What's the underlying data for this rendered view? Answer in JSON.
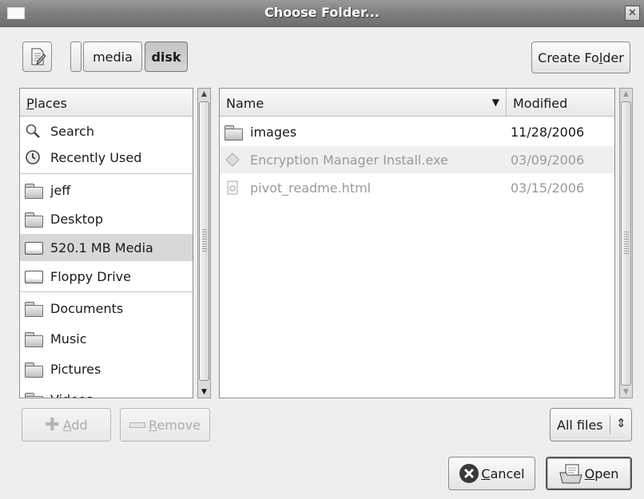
{
  "window": {
    "title": "Choose Folder...",
    "close_glyph": "✕"
  },
  "toolbar": {
    "edit_icon": "text-editor-icon",
    "path_segments": [
      {
        "label": "media",
        "active": false
      },
      {
        "label": "disk",
        "active": true
      }
    ],
    "create_folder_label": "Create Folder",
    "create_folder_mnemonic": "l"
  },
  "places": {
    "header": "Places",
    "header_mnemonic": "P",
    "items": [
      {
        "label": "Search",
        "icon": "magnifier-icon",
        "group": 1,
        "selected": false
      },
      {
        "label": "Recently Used",
        "icon": "clock-icon",
        "group": 1,
        "selected": false
      },
      {
        "label": "jeff",
        "icon": "folder-icon",
        "group": 2,
        "selected": false
      },
      {
        "label": "Desktop",
        "icon": "folder-icon",
        "group": 2,
        "selected": false
      },
      {
        "label": "520.1 MB Media",
        "icon": "drive-icon",
        "group": 2,
        "selected": true
      },
      {
        "label": "Floppy Drive",
        "icon": "drive-icon",
        "group": 2,
        "selected": false
      },
      {
        "label": "Documents",
        "icon": "folder-icon",
        "group": 3,
        "selected": false
      },
      {
        "label": "Music",
        "icon": "folder-icon",
        "group": 3,
        "selected": false
      },
      {
        "label": "Pictures",
        "icon": "folder-icon",
        "group": 3,
        "selected": false
      },
      {
        "label": "Videos",
        "icon": "folder-icon",
        "group": 3,
        "selected": false
      }
    ],
    "add_label": "Add",
    "remove_label": "Remove"
  },
  "files": {
    "col_name": "Name",
    "col_modified": "Modified",
    "sort_indicator": "▼",
    "rows": [
      {
        "name": "images",
        "modified": "11/28/2006",
        "icon": "folder-icon",
        "enabled": true
      },
      {
        "name": "Encryption Manager Install.exe",
        "modified": "03/09/2006",
        "icon": "executable-icon",
        "enabled": false
      },
      {
        "name": "pivot_readme.html",
        "modified": "03/15/2006",
        "icon": "html-file-icon",
        "enabled": false
      }
    ]
  },
  "filter": {
    "selected": "All files",
    "spinner": "⇕"
  },
  "actions": {
    "cancel_label": "Cancel",
    "open_label": "Open"
  },
  "colors": {
    "title_bar": "#7e7e7e",
    "selection": "#d8d8d8",
    "stripe": "#efefef"
  }
}
